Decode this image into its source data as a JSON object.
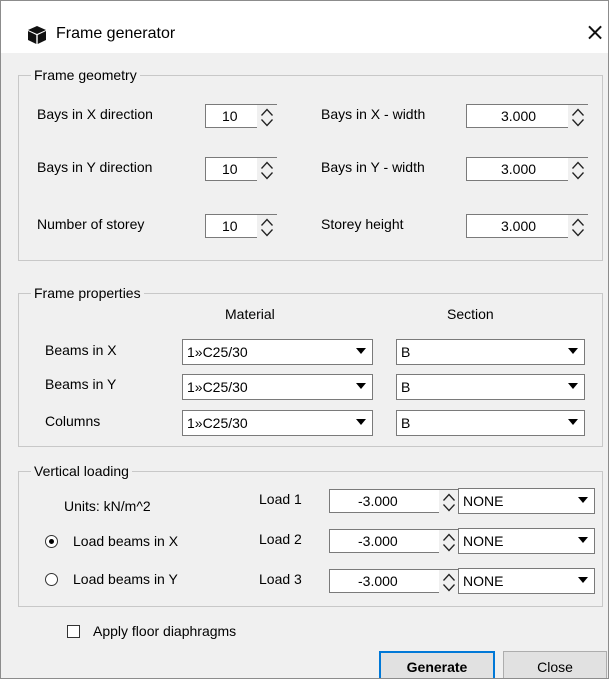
{
  "window": {
    "title": "Frame generator",
    "close_glyph": "×",
    "icon": "cube-icon"
  },
  "geometry": {
    "legend": "Frame geometry",
    "fields": [
      {
        "label": "Bays in X direction",
        "value": "10"
      },
      {
        "label": "Bays in Y direction",
        "value": "10"
      },
      {
        "label": "Number of storey",
        "value": "10"
      },
      {
        "label": "Bays in X - width",
        "value": "3.000"
      },
      {
        "label": "Bays in Y - width",
        "value": "3.000"
      },
      {
        "label": "Storey height",
        "value": "3.000"
      }
    ]
  },
  "properties": {
    "legend": "Frame properties",
    "material_header": "Material",
    "section_header": "Section",
    "rows": [
      {
        "label": "Beams in X",
        "material": "1»C25/30",
        "section": "B"
      },
      {
        "label": "Beams in Y",
        "material": "1»C25/30",
        "section": "B"
      },
      {
        "label": "Columns",
        "material": "1»C25/30",
        "section": "B"
      }
    ]
  },
  "loading": {
    "legend": "Vertical loading",
    "units": "Units: kN/m^2",
    "options": [
      {
        "label": "Load beams in X",
        "checked": true
      },
      {
        "label": "Load beams in Y",
        "checked": false
      }
    ],
    "loads": [
      {
        "label": "Load 1",
        "value": "-3.000",
        "type": "NONE"
      },
      {
        "label": "Load 2",
        "value": "-3.000",
        "type": "NONE"
      },
      {
        "label": "Load 3",
        "value": "-3.000",
        "type": "NONE"
      }
    ]
  },
  "diaphragm": {
    "label": "Apply floor diaphragms",
    "checked": false
  },
  "buttons": {
    "generate": "Generate",
    "close": "Close"
  },
  "colors": {
    "accent": "#0078d7",
    "dialog_bg": "#f0f0f0",
    "border": "#7a7a7a"
  }
}
